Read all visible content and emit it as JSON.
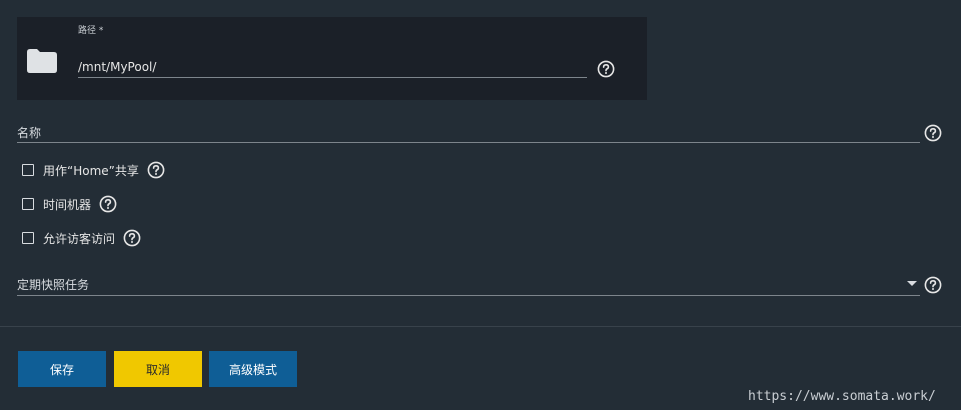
{
  "path_panel": {
    "label": "路径 *",
    "value": "/mnt/MyPool/",
    "folder_icon": "folder-icon",
    "help_icon": "help-icon"
  },
  "name_field": {
    "label": "名称",
    "help_icon": "help-icon"
  },
  "options": [
    {
      "label": "用作“Home”共享",
      "checked": false
    },
    {
      "label": "时间机器",
      "checked": false
    },
    {
      "label": "允许访客访问",
      "checked": false
    }
  ],
  "snapshot_field": {
    "label": "定期快照任务",
    "help_icon": "help-icon"
  },
  "buttons": {
    "save": "保存",
    "cancel": "取消",
    "advanced": "高级模式"
  },
  "colors": {
    "background": "#232d36",
    "panel": "#1b2028",
    "primary": "#0f5e96",
    "warning": "#f0c800"
  },
  "watermark": "https://www.somata.work/"
}
